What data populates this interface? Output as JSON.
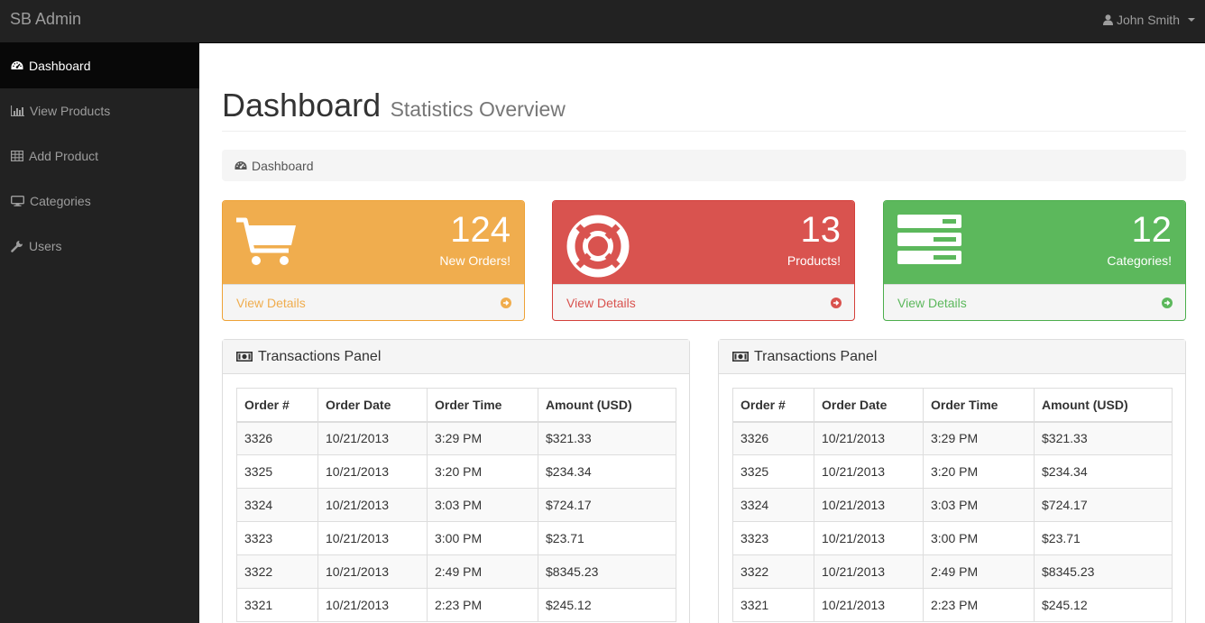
{
  "app": {
    "brand": "SB Admin",
    "user_name": "John Smith"
  },
  "sidebar": {
    "items": [
      {
        "label": "Dashboard",
        "icon": "dashboard-icon",
        "active": true
      },
      {
        "label": "View Products",
        "icon": "bar-chart-icon"
      },
      {
        "label": "Add Product",
        "icon": "table-icon"
      },
      {
        "label": "Categories",
        "icon": "desktop-icon"
      },
      {
        "label": "Users",
        "icon": "wrench-icon"
      }
    ]
  },
  "page": {
    "title": "Dashboard",
    "subtitle": "Statistics Overview",
    "breadcrumb": "Dashboard"
  },
  "cards": [
    {
      "count": "124",
      "label": "New Orders!",
      "link": "View Details",
      "icon": "cart-icon",
      "color": "#f0ad4e",
      "border": "#eea236"
    },
    {
      "count": "13",
      "label": "Products!",
      "link": "View Details",
      "icon": "life-ring-icon",
      "color": "#d9534f",
      "border": "#d43f3a"
    },
    {
      "count": "12",
      "label": "Categories!",
      "link": "View Details",
      "icon": "list-icon",
      "color": "#5cb85c",
      "border": "#4cae4c"
    }
  ],
  "panels": [
    {
      "title": "Transactions Panel",
      "columns": [
        "Order #",
        "Order Date",
        "Order Time",
        "Amount (USD)"
      ],
      "rows": [
        [
          "3326",
          "10/21/2013",
          "3:29 PM",
          "$321.33"
        ],
        [
          "3325",
          "10/21/2013",
          "3:20 PM",
          "$234.34"
        ],
        [
          "3324",
          "10/21/2013",
          "3:03 PM",
          "$724.17"
        ],
        [
          "3323",
          "10/21/2013",
          "3:00 PM",
          "$23.71"
        ],
        [
          "3322",
          "10/21/2013",
          "2:49 PM",
          "$8345.23"
        ],
        [
          "3321",
          "10/21/2013",
          "2:23 PM",
          "$245.12"
        ]
      ]
    },
    {
      "title": "Transactions Panel",
      "columns": [
        "Order #",
        "Order Date",
        "Order Time",
        "Amount (USD)"
      ],
      "rows": [
        [
          "3326",
          "10/21/2013",
          "3:29 PM",
          "$321.33"
        ],
        [
          "3325",
          "10/21/2013",
          "3:20 PM",
          "$234.34"
        ],
        [
          "3324",
          "10/21/2013",
          "3:03 PM",
          "$724.17"
        ],
        [
          "3323",
          "10/21/2013",
          "3:00 PM",
          "$23.71"
        ],
        [
          "3322",
          "10/21/2013",
          "2:49 PM",
          "$8345.23"
        ],
        [
          "3321",
          "10/21/2013",
          "2:23 PM",
          "$245.12"
        ]
      ]
    }
  ]
}
